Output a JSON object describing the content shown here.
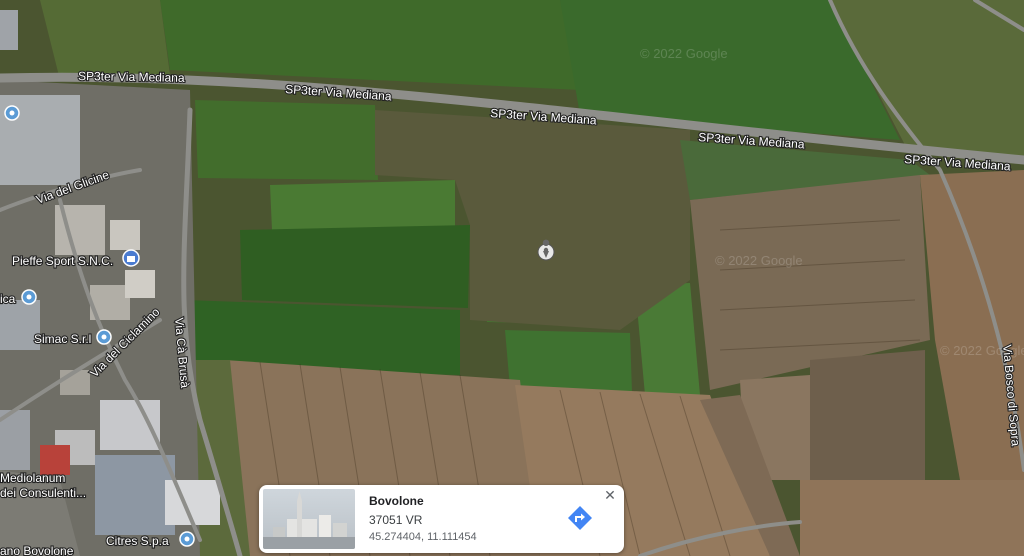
{
  "roads": {
    "sp3ter": "SP3ter Via Mediana",
    "glicine": "Via del Glicine",
    "ciclamino": "Via del Ciclamino",
    "ca_brusa": "Via Cà Brusà",
    "bosco_sopra": "Via Bosco di Sopra"
  },
  "places": {
    "pieffe": "Pieffe Sport S.N.C.",
    "simac": "Simac S.r.l",
    "ica": "ica",
    "mediolanum_1": "Mediolanum",
    "mediolanum_2": "dei Consulenti...",
    "citres": "Citres S.p.a",
    "bovolone_label": "ano Bovolone"
  },
  "watermark": "© 2022 Google",
  "info_card": {
    "title": "Bovolone",
    "postal": "37051 VR",
    "coords": "45.274404, 11.111454",
    "close": "✕"
  },
  "colors": {
    "pin_blue": "#5b9bd5",
    "direction_blue": "#4285f4"
  }
}
